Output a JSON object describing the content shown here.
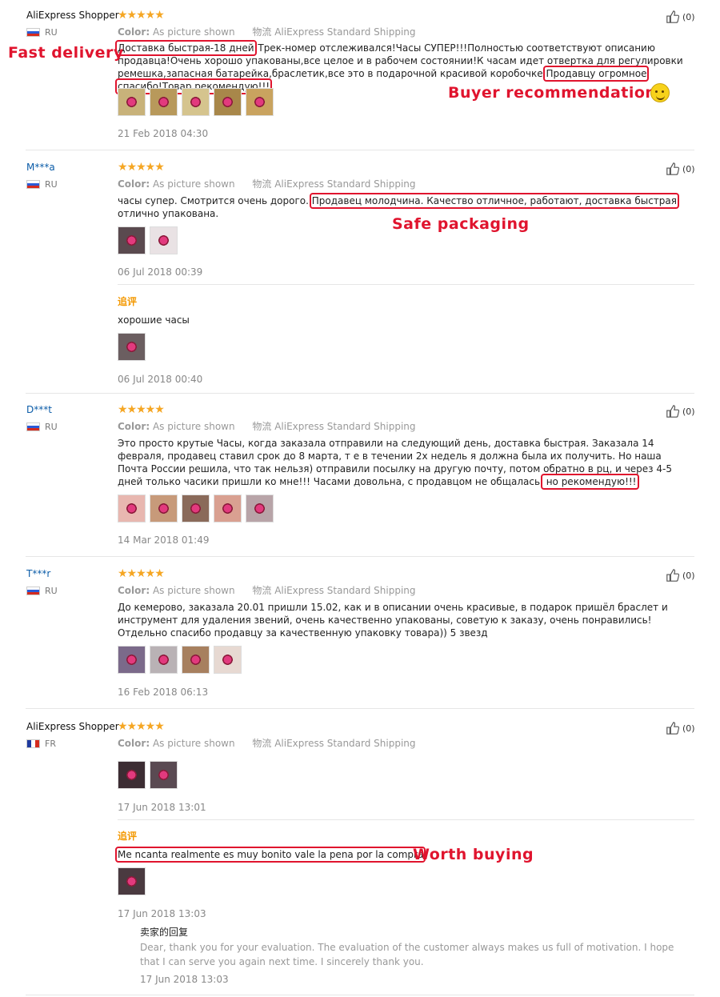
{
  "colors": {
    "accent_red": "#e0142e",
    "star": "#f5a623",
    "addtag": "#f39800",
    "masked_name": "#0b5ca8"
  },
  "common": {
    "color_label": "Color:",
    "color_value": "As picture shown",
    "shipping": "物流 AliExpress Standard Shipping",
    "additional_tag": "追评",
    "stars": "★★★★★",
    "like_count": "(0)"
  },
  "annotations": {
    "fast_delivery": "Fast delivery",
    "buyer_recommendation": "Buyer recommendation!",
    "safe_packaging": "Safe packaging",
    "worth_buying": "Worth buying"
  },
  "reviews": [
    {
      "user": "AliExpress Shopper",
      "country": "RU",
      "text_hl1": "Доставка быстрая-18 дней",
      "text_mid": "!Трек-номер отслеживался!Часы СУПЕР!!!Полностью соответствуют описанию продавца!Очень хорошо упакованы,все целое и в рабочем состоянии!К часам идет отвертка для регулировки ремешка,запасная батарейка,браслетик,все это в подарочной красивой коробочке",
      "text_hl2": "Продавцу огромное спасибо!Товар рекомендую!!!",
      "date": "21 Feb 2018 04:30"
    },
    {
      "user": "M***a",
      "country": "RU",
      "text_pre": "часы супер. Смотрится очень дорого.",
      "text_hl": "Продавец молодчина. Качество отличное, работают, доставка быстрая",
      "text_post": " отлично упакована.",
      "date": "06 Jul 2018 00:39",
      "additional_text": "хорошие часы",
      "additional_date": "06 Jul 2018 00:40"
    },
    {
      "user": "D***t",
      "country": "RU",
      "text_pre": "Это просто крутые Часы, когда заказала отправили на следующий день, доставка быстрая. Заказала 14 февраля, продавец ставил срок до 8 марта, т е в течении 2х недель я должна была их получить. Но наша Почта России решила, что так нельзя) отправили посылку на другую почту, потом обратно в рц, и через 4-5 дней только часики пришли ко мне!!! Часами довольна, с продавцом не общалась,",
      "text_hl": " но рекомендую!!!",
      "date": "14 Mar 2018 01:49"
    },
    {
      "user": "T***r",
      "country": "RU",
      "text": "До кемерово, заказала 20.01 пришли 15.02, как и в описании очень красивые, в подарок пришёл браслет и инструмент для удаления звений, очень качественно упакованы, советую к заказу, очень понравились! Отдельно спасибо продавцу за качественную упаковку товара)) 5 звезд",
      "date": "16 Feb 2018 06:13"
    },
    {
      "user": "AliExpress Shopper",
      "country": "FR",
      "date": "17 Jun 2018 13:01",
      "additional_text": "Me ncanta realmente es muy bonito vale la pena por la compra",
      "additional_date": "17 Jun 2018 13:03",
      "seller_reply_title": "卖家的回复",
      "seller_reply_text": "Dear, thank you for your evaluation. The evaluation of the customer always makes us full of motivation. I hope that I can serve you again next time. I sincerely thank you.",
      "seller_reply_date": "17 Jun 2018 13:03"
    }
  ]
}
